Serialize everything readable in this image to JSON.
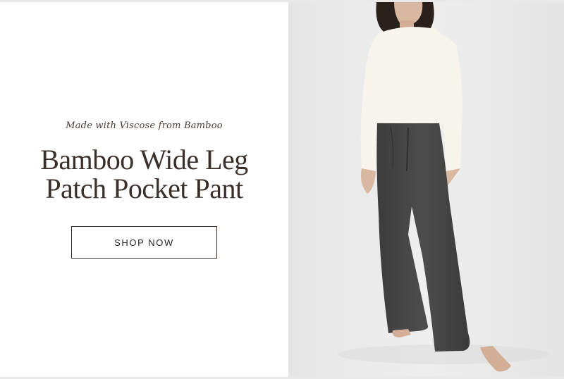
{
  "hero": {
    "eyebrow": "Made with Viscose from Bamboo",
    "headline_line1": "Bamboo Wide Leg",
    "headline_line2": "Patch Pocket Pant",
    "cta_label": "SHOP NOW"
  },
  "colors": {
    "text_brown": "#3b2f2a",
    "photo_background": "#ebebeb",
    "sweater": "#f7f5ee",
    "pants": "#474747"
  },
  "image": {
    "description_icon": "model-photo"
  }
}
